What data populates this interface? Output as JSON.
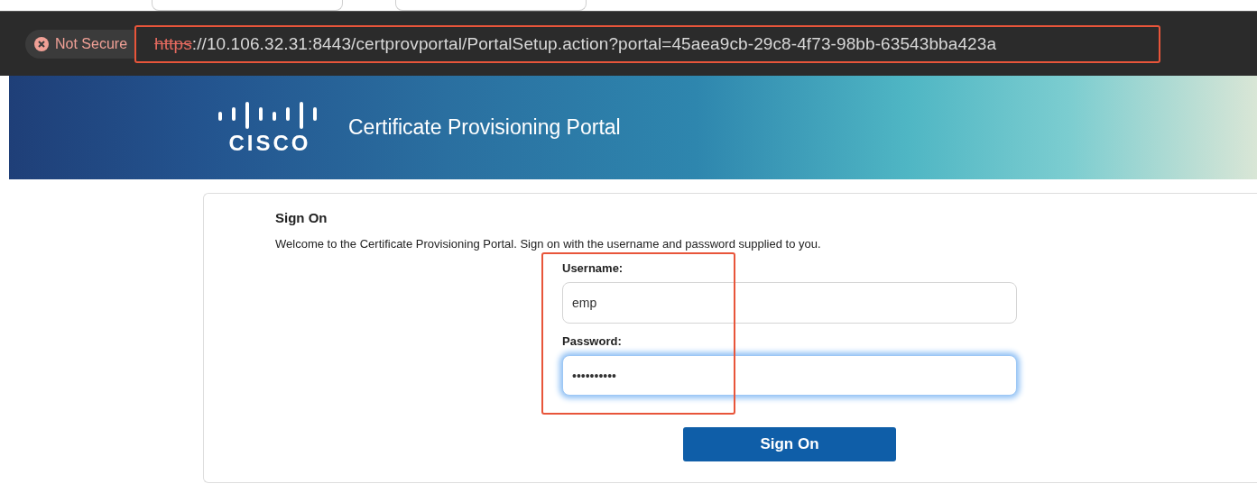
{
  "browser": {
    "security": {
      "label": "Not Secure",
      "insecure": true
    },
    "url": {
      "scheme": "https",
      "rest": "://10.106.32.31:8443/certprovportal/PortalSetup.action?portal=45aea9cb-29c8-4f73-98bb-63543bba423a",
      "highlighted": true
    }
  },
  "banner": {
    "logo_text": "CISCO",
    "title": "Certificate Provisioning Portal"
  },
  "sign_on": {
    "heading": "Sign On",
    "message": "Welcome to the Certificate Provisioning Portal. Sign on with the username and password supplied to you.",
    "fields": [
      {
        "label": "Username:",
        "value": "emp",
        "focused": false
      },
      {
        "label": "Password:",
        "value": "••••••••••",
        "focused": true
      }
    ],
    "fields_highlighted": true,
    "button": "Sign On"
  }
}
